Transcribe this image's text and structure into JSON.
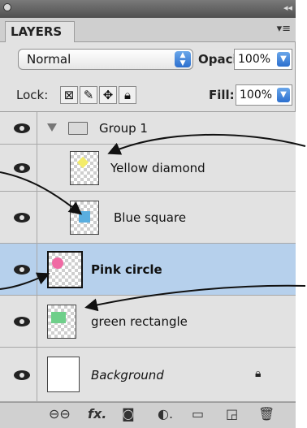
{
  "panel": {
    "tab_label": "LAYERS",
    "menu_icon": "panel-menu-icon",
    "blend_mode": "Normal",
    "opacity_label": "Opacity:",
    "opacity_value": "100%",
    "lock_label": "Lock:",
    "fill_label": "Fill:",
    "fill_value": "100%"
  },
  "layers": [
    {
      "name": "Group 1",
      "type": "group",
      "visible": true
    },
    {
      "name": "Yellow diamond",
      "type": "layer",
      "visible": true,
      "swatch": "#f3ec6a"
    },
    {
      "name": "Blue square",
      "type": "layer",
      "visible": true,
      "swatch": "#5aaedf"
    },
    {
      "name": "Pink circle",
      "type": "layer",
      "visible": true,
      "selected": true,
      "swatch": "#f06aa4"
    },
    {
      "name": "green rectangle",
      "type": "layer",
      "visible": true,
      "swatch": "#6fcf8a"
    },
    {
      "name": "Background",
      "type": "background",
      "visible": true,
      "locked": true
    }
  ],
  "colors": {
    "selection": "#b6d0ec",
    "accent": "#2c6fce"
  },
  "bottom_icons": [
    "link-icon",
    "fx-icon",
    "mask-icon",
    "adjustment-icon",
    "folder-icon",
    "new-layer-icon",
    "trash-icon"
  ]
}
